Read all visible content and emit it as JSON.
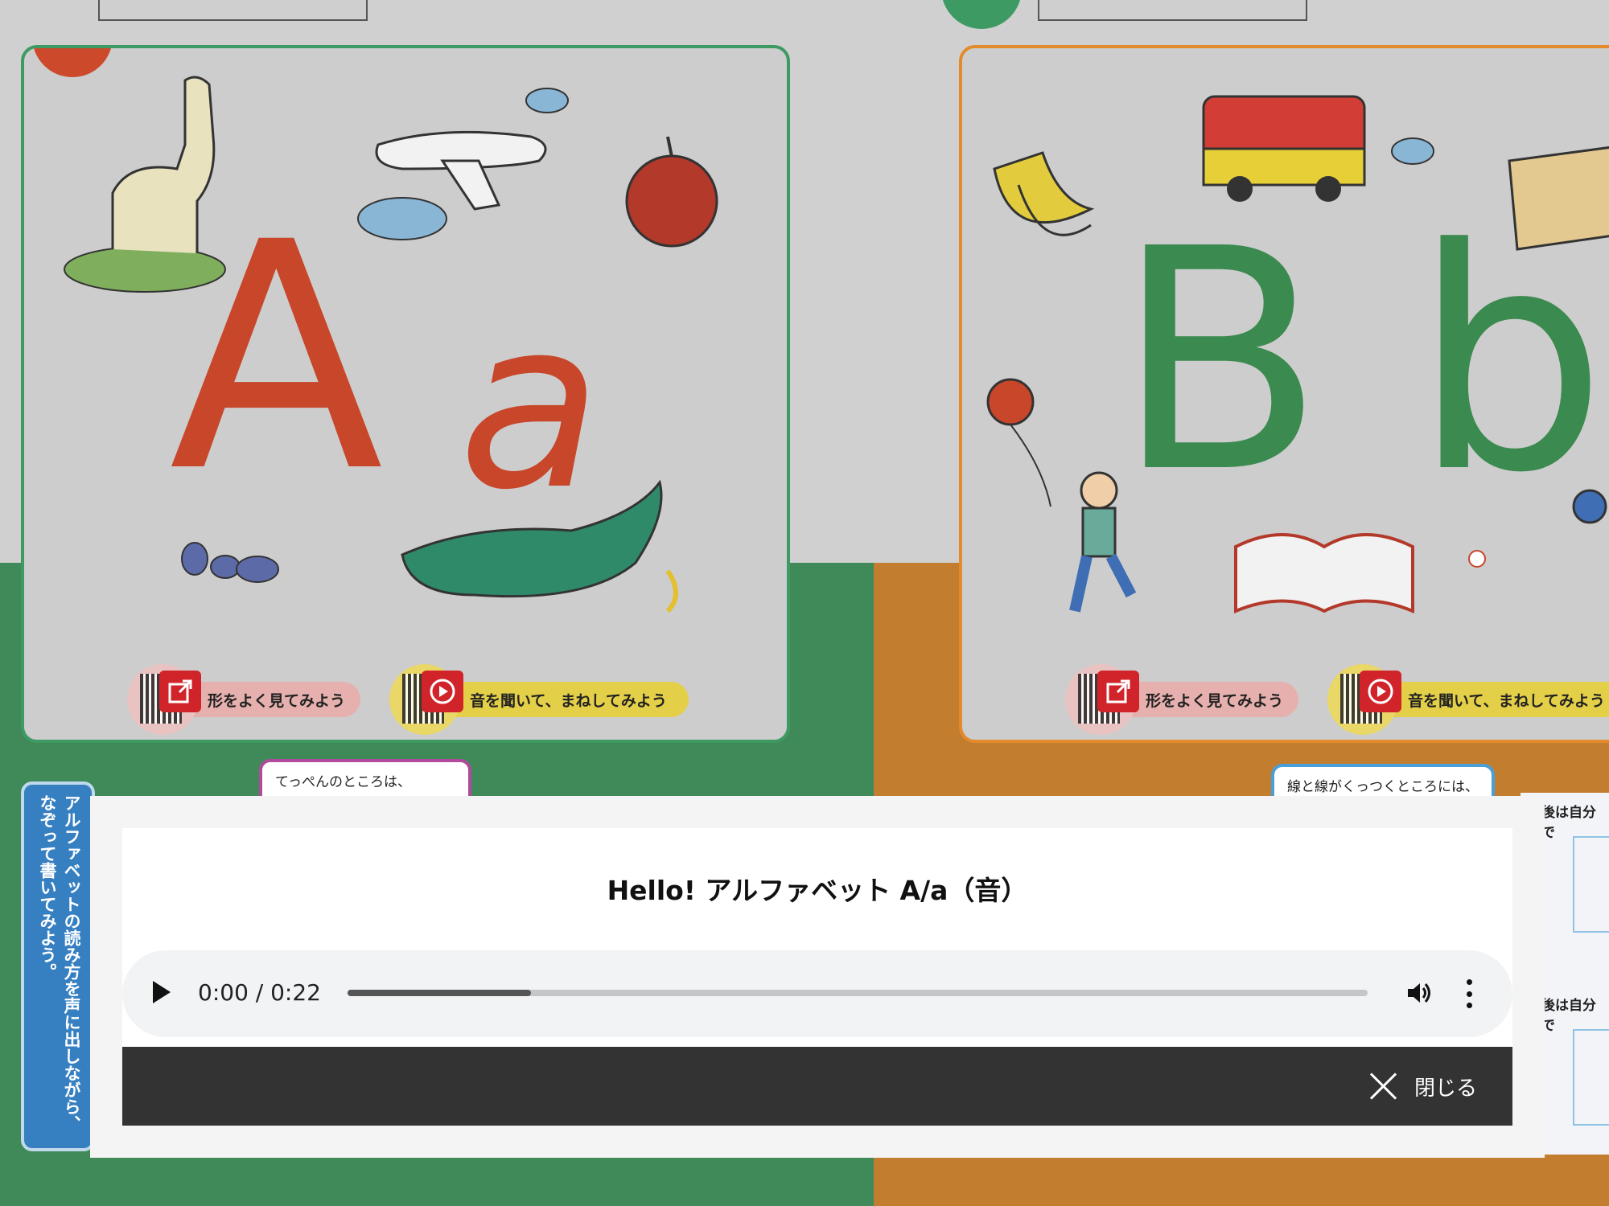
{
  "background": {
    "card_a": {
      "upper": "A",
      "lower": "a",
      "letter_color": "#c8462a",
      "border_color": "#3e9a63",
      "pill_look": "形をよく見てみよう",
      "pill_listen": "音を聞いて、まねしてみよう"
    },
    "card_b": {
      "upper": "B",
      "lower": "b",
      "letter_color": "#3b8a4f",
      "border_color": "#e38b2c",
      "pill_look": "形をよく見てみよう",
      "pill_listen": "音を聞いて、まねしてみよう"
    },
    "side_instruction": "アルファベットの読み方を声に出しながら、なぞって書いてみよう。",
    "bubble_a": "てっぺんのところは、",
    "bubble_b": "線と線がくっつくところには、",
    "right_text_1": "後は自分で",
    "right_text_2": "後は自分で"
  },
  "modal": {
    "title": "Hello! アルファベット A/a（音）",
    "player": {
      "time_display": "0:00 / 0:22",
      "current": "0:00",
      "duration": "0:22",
      "buffered_fraction": 0.18,
      "play_icon": "play-icon",
      "volume_icon": "volume-icon",
      "menu_icon": "more-vert-icon"
    },
    "close_label": "閉じる",
    "close_icon": "close-icon"
  }
}
